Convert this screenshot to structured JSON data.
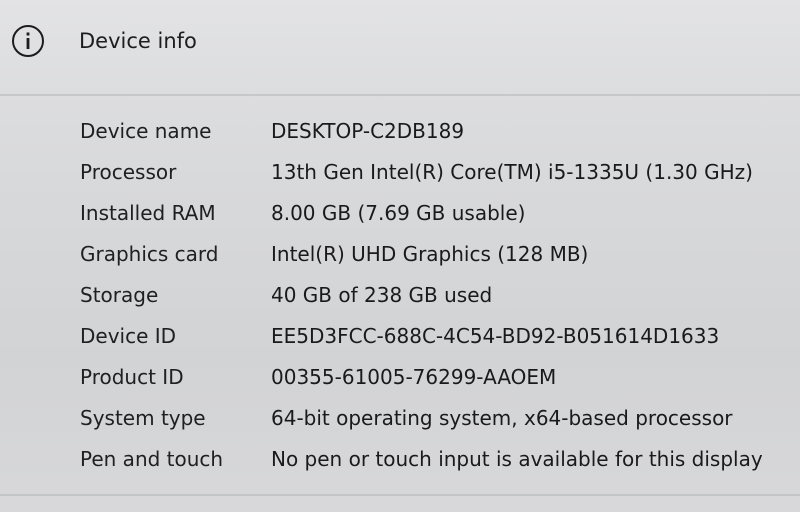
{
  "header": {
    "icon": "info-icon",
    "title": "Device info"
  },
  "specs": [
    {
      "label": "Device name",
      "value": "DESKTOP-C2DB189"
    },
    {
      "label": "Processor",
      "value": "13th Gen Intel(R) Core(TM) i5-1335U (1.30 GHz)"
    },
    {
      "label": "Installed RAM",
      "value": "8.00 GB (7.69 GB usable)"
    },
    {
      "label": "Graphics card",
      "value": "Intel(R) UHD Graphics (128 MB)"
    },
    {
      "label": "Storage",
      "value": "40 GB of 238 GB used"
    },
    {
      "label": "Device ID",
      "value": "EE5D3FCC-688C-4C54-BD92-B051614D1633"
    },
    {
      "label": "Product ID",
      "value": "00355-61005-76299-AAOEM"
    },
    {
      "label": "System type",
      "value": "64-bit operating system, x64-based processor"
    },
    {
      "label": "Pen and touch",
      "value": "No pen or touch input is available for this display"
    }
  ]
}
